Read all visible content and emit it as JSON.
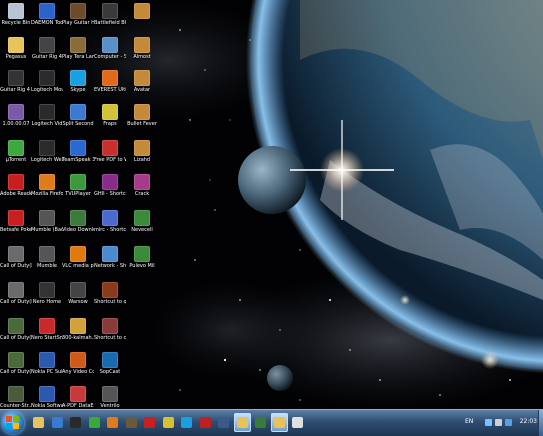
{
  "desktop": {
    "icons": [
      {
        "label": "Recycle Bin",
        "icon": "recycle-bin-icon",
        "color": "#b8c4d4",
        "interactable": true
      },
      {
        "label": "DAEMON Tools Lite",
        "icon": "daemon-tools-icon",
        "color": "#2a63c9"
      },
      {
        "label": "Play Guitar Hero III",
        "icon": "guitar-hero-icon",
        "color": "#6d4a2a"
      },
      {
        "label": "Battlefield BC2",
        "icon": "battlefield-icon",
        "color": "#3a3a3a"
      },
      {
        "label": "",
        "icon": "winrar-archive-icon",
        "color": "#c48a3a"
      },
      {
        "label": "Pegasus",
        "icon": "folder-icon",
        "color": "#e7c35a"
      },
      {
        "label": "Guitar Rig 4",
        "icon": "guitar-rig-icon",
        "color": "#444444"
      },
      {
        "label": "Play Tera Land of E...",
        "icon": "game-icon",
        "color": "#8a6b3a"
      },
      {
        "label": "Computer - Shortcut",
        "icon": "computer-icon",
        "color": "#5a8fc8"
      },
      {
        "label": "Almost",
        "icon": "winrar-archive-icon",
        "color": "#c48a3a"
      },
      {
        "label": "Guitar Rig 4 Setup PC",
        "icon": "guitar-rig-setup-icon",
        "color": "#333333"
      },
      {
        "label": "Logitech Mouse a...",
        "icon": "logitech-icon",
        "color": "#2a2a2a"
      },
      {
        "label": "Skype",
        "icon": "skype-icon",
        "color": "#1aa0e0"
      },
      {
        "label": "EVEREST Ultima...",
        "icon": "everest-icon",
        "color": "#e06a1a"
      },
      {
        "label": "Avatar",
        "icon": "winrar-archive-icon",
        "color": "#c48a3a"
      },
      {
        "label": "1.00.00.07",
        "icon": "file-icon",
        "color": "#7a5aa8"
      },
      {
        "label": "Logitech Vid",
        "icon": "logitech-vid-icon",
        "color": "#2a2a2a"
      },
      {
        "label": "Split Second",
        "icon": "split-second-icon",
        "color": "#3c7ad0"
      },
      {
        "label": "Fraps",
        "icon": "fraps-icon",
        "color": "#d2c23a"
      },
      {
        "label": "Bullet Fever",
        "icon": "winrar-archive-icon",
        "color": "#c48a3a"
      },
      {
        "label": "µTorrent",
        "icon": "utorrent-icon",
        "color": "#3fa83f"
      },
      {
        "label": "Logitech Webca...",
        "icon": "webcam-icon",
        "color": "#2a2a2a"
      },
      {
        "label": "TeamSpeak 3 Client",
        "icon": "teamspeak-icon",
        "color": "#2a6ad0"
      },
      {
        "label": "Free PDF to Word Do...",
        "icon": "pdf-to-word-icon",
        "color": "#c83030"
      },
      {
        "label": "Lizahd",
        "icon": "winrar-archive-icon",
        "color": "#c48a3a"
      },
      {
        "label": "Adobe Reader 9",
        "icon": "adobe-reader-icon",
        "color": "#c81e1e"
      },
      {
        "label": "Mozilla Firefox",
        "icon": "firefox-icon",
        "color": "#e07a1a"
      },
      {
        "label": "TVUPlayer",
        "icon": "tvuplayer-icon",
        "color": "#3a9a3a"
      },
      {
        "label": "GHII - Shortcut",
        "icon": "shortcut-icon",
        "color": "#8a2a8a"
      },
      {
        "label": "Crack",
        "icon": "winrar-archive-icon",
        "color": "#a83a8a"
      },
      {
        "label": "Betsafe Poker",
        "icon": "poker-icon",
        "color": "#c82020"
      },
      {
        "label": "Mumble (Backward...",
        "icon": "mumble-icon",
        "color": "#555555"
      },
      {
        "label": "Video Downlo...",
        "icon": "video-download-icon",
        "color": "#3a7a3a"
      },
      {
        "label": "mirc - Shortcut",
        "icon": "mirc-icon",
        "color": "#4a6ad0"
      },
      {
        "label": "Nevecell",
        "icon": "winrar-archive-icon",
        "color": "#3a8a3a"
      },
      {
        "label": "Call of Duty(R) 2...",
        "icon": "call-of-duty-icon",
        "color": "#6a6a6a"
      },
      {
        "label": "Mumble",
        "icon": "mumble-icon",
        "color": "#555555"
      },
      {
        "label": "VLC media player",
        "icon": "vlc-icon",
        "color": "#e07a10"
      },
      {
        "label": "Network - Shortcut",
        "icon": "network-icon",
        "color": "#4a8ad0"
      },
      {
        "label": "Pulevo Mil",
        "icon": "winrar-archive-icon",
        "color": "#3a8a3a"
      },
      {
        "label": "Call of Duty(R) 2...",
        "icon": "call-of-duty-icon",
        "color": "#6a6a6a"
      },
      {
        "label": "Nero Home",
        "icon": "nero-icon",
        "color": "#333333"
      },
      {
        "label": "Warsow",
        "icon": "warsow-icon",
        "color": "#444444"
      },
      {
        "label": "Shortcut to quake3",
        "icon": "quake-icon",
        "color": "#8a3a1a"
      },
      {
        "label": "",
        "icon": "",
        "color": ""
      },
      {
        "label": "Call of Duty(R) 4 -...",
        "icon": "call-of-duty-icon",
        "color": "#4a6a3a"
      },
      {
        "label": "Nero StartSmart",
        "icon": "nero-startsmart-icon",
        "color": "#c82a2a"
      },
      {
        "label": "300-kalmah... Shortcut",
        "icon": "audio-shortcut-icon",
        "color": "#d2a23a"
      },
      {
        "label": "Shortcut to cfg2",
        "icon": "config-icon",
        "color": "#8a3a3a"
      },
      {
        "label": "",
        "icon": "",
        "color": ""
      },
      {
        "label": "Call of Duty(R) 4 -...",
        "icon": "call-of-duty-icon",
        "color": "#4a6a3a"
      },
      {
        "label": "Nokia PC Suite",
        "icon": "nokia-pc-suite-icon",
        "color": "#2a5ab0"
      },
      {
        "label": "Any Video Converter ...",
        "icon": "video-converter-icon",
        "color": "#d05a1a"
      },
      {
        "label": "SopCast",
        "icon": "sopcast-icon",
        "color": "#1a6ab0"
      },
      {
        "label": "",
        "icon": "",
        "color": ""
      },
      {
        "label": "Counter-Str... 1.6 (protoc...",
        "icon": "counter-strike-icon",
        "color": "#4a5a3a"
      },
      {
        "label": "Nokia Softwa...",
        "icon": "nokia-software-icon",
        "color": "#2a5ab0"
      },
      {
        "label": "A-PDF DataExtractor",
        "icon": "pdf-extractor-icon",
        "color": "#c83a3a"
      },
      {
        "label": "Ventrilo",
        "icon": "ventrilo-icon",
        "color": "#555555"
      },
      {
        "label": "",
        "icon": "",
        "color": ""
      }
    ]
  },
  "taskbar": {
    "pinned": [
      {
        "icon": "explorer-icon",
        "color": "#e7c35a"
      },
      {
        "icon": "media-player-icon",
        "color": "#3a7ad0"
      },
      {
        "icon": "game-icon",
        "color": "#2a2a2a"
      },
      {
        "icon": "map-pin-icon",
        "color": "#3aa83a"
      },
      {
        "icon": "firefox-icon",
        "color": "#e07a1a"
      },
      {
        "icon": "counter-strike-icon",
        "color": "#6a5a3a"
      },
      {
        "icon": "redcross-icon",
        "color": "#c82020"
      },
      {
        "icon": "chrome-icon",
        "color": "#d8c030"
      },
      {
        "icon": "skype-icon",
        "color": "#1aa0e0"
      },
      {
        "icon": "flash-icon",
        "color": "#c02020"
      },
      {
        "icon": "steam-icon",
        "color": "#3a5a8a"
      },
      {
        "icon": "folder-icon",
        "color": "#e7c35a",
        "active": true
      },
      {
        "icon": "game-icon",
        "color": "#3a7a3a"
      },
      {
        "icon": "folder-icon",
        "color": "#e7c35a",
        "active": true
      },
      {
        "icon": "chat-icon",
        "color": "#e0e0e0"
      }
    ],
    "language": "EN",
    "clock": "22:03"
  }
}
